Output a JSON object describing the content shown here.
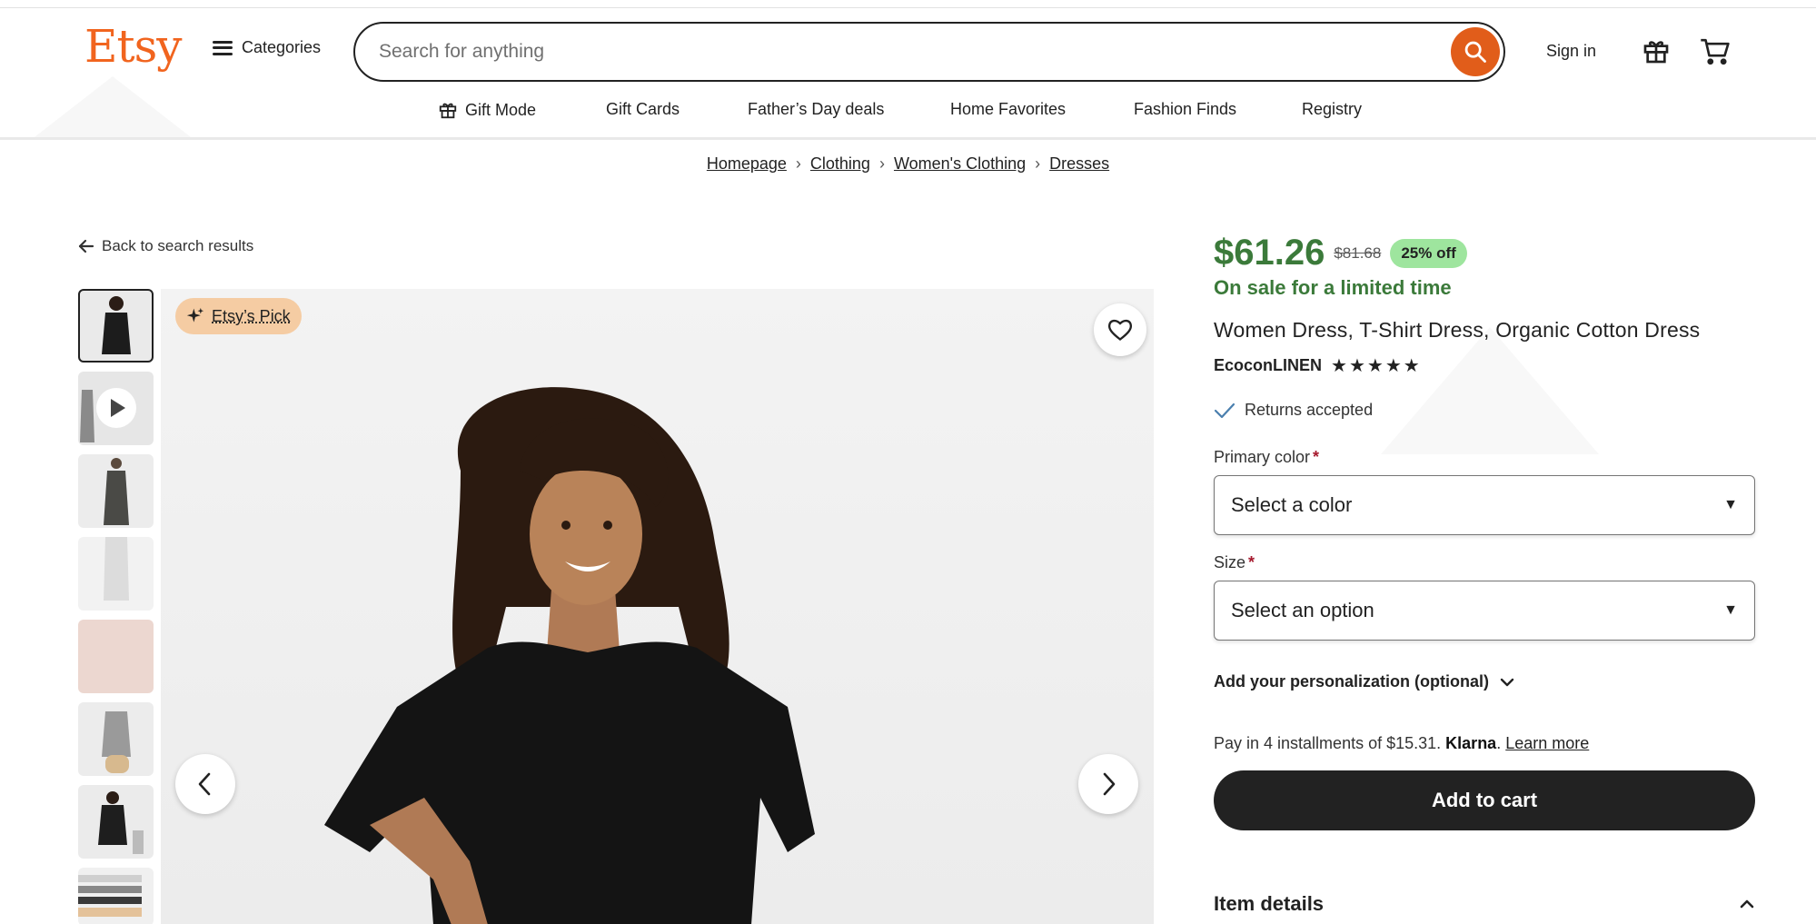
{
  "header": {
    "logo": "Etsy",
    "categories_label": "Categories",
    "search_placeholder": "Search for anything",
    "sign_in": "Sign in"
  },
  "subnav": [
    {
      "label": "Gift Mode",
      "icon": "gift-icon"
    },
    {
      "label": "Gift Cards"
    },
    {
      "label": "Father’s Day deals"
    },
    {
      "label": "Home Favorites"
    },
    {
      "label": "Fashion Finds"
    },
    {
      "label": "Registry"
    }
  ],
  "breadcrumb": [
    "Homepage",
    "Clothing",
    "Women's Clothing",
    "Dresses"
  ],
  "back_link": "Back to search results",
  "gallery": {
    "badge": "Etsy’s Pick",
    "thumbnail_count": 8,
    "active_index": 0,
    "video_thumbnail_index": 1
  },
  "product": {
    "price": "$61.26",
    "original_price": "$81.68",
    "discount": "25% off",
    "sale_note": "On sale for a limited time",
    "title": "Women Dress, T-Shirt Dress, Organic Cotton Dress",
    "shop": "EcoconLINEN",
    "rating_stars": 5,
    "returns": "Returns accepted"
  },
  "options": {
    "color_label": "Primary color",
    "color_value": "Select a color",
    "size_label": "Size",
    "size_value": "Select an option",
    "required_mark": "*"
  },
  "personalization": "Add your personalization (optional)",
  "klarna": {
    "text": "Pay in 4 installments of $15.31.",
    "brand": "Klarna",
    "period": ".",
    "learn_more": "Learn more"
  },
  "add_to_cart": "Add to cart",
  "item_details": "Item details",
  "colors": {
    "brand_orange": "#F1641E",
    "sale_green": "#3B7A3A",
    "discount_bg": "#9EE59E",
    "pick_badge_bg": "#F5CCA3"
  }
}
